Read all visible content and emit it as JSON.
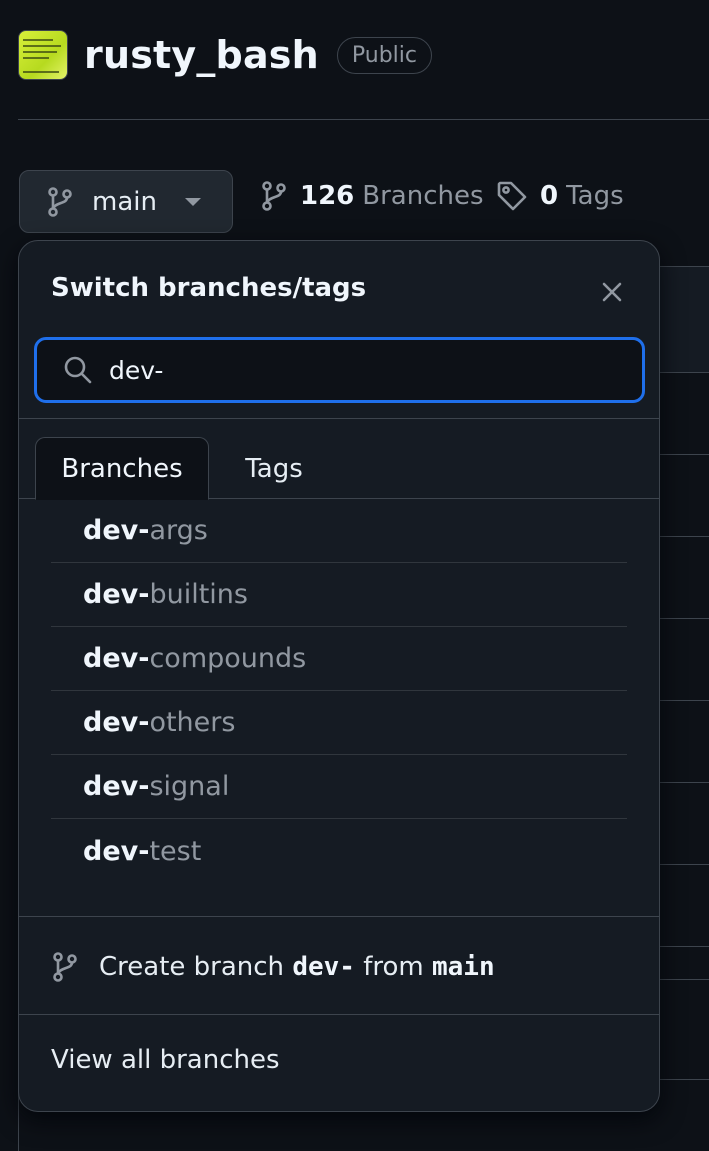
{
  "repo": {
    "name": "rusty_bash",
    "visibility": "Public",
    "avatar_icon": "book-cover-avatar"
  },
  "branch_bar": {
    "current_branch": "main",
    "branches_count": "126",
    "branches_label": "Branches",
    "tags_count": "0",
    "tags_label": "Tags"
  },
  "dropdown": {
    "title": "Switch branches/tags",
    "search_value": "dev-",
    "tabs": [
      {
        "label": "Branches",
        "active": true
      },
      {
        "label": "Tags",
        "active": false
      }
    ],
    "items": [
      {
        "match": "dev-",
        "rest": "args"
      },
      {
        "match": "dev-",
        "rest": "builtins"
      },
      {
        "match": "dev-",
        "rest": "compounds"
      },
      {
        "match": "dev-",
        "rest": "others"
      },
      {
        "match": "dev-",
        "rest": "signal"
      },
      {
        "match": "dev-",
        "rest": "test"
      }
    ],
    "create": {
      "prefix": "Create branch",
      "name": "dev-",
      "middle": "from",
      "source": "main"
    },
    "view_all_label": "View all branches"
  },
  "colors": {
    "background": "#0d1117",
    "panel": "#151b23",
    "focus_border": "#1f6feb",
    "muted_text": "#9198a1",
    "border": "#3d444d"
  }
}
